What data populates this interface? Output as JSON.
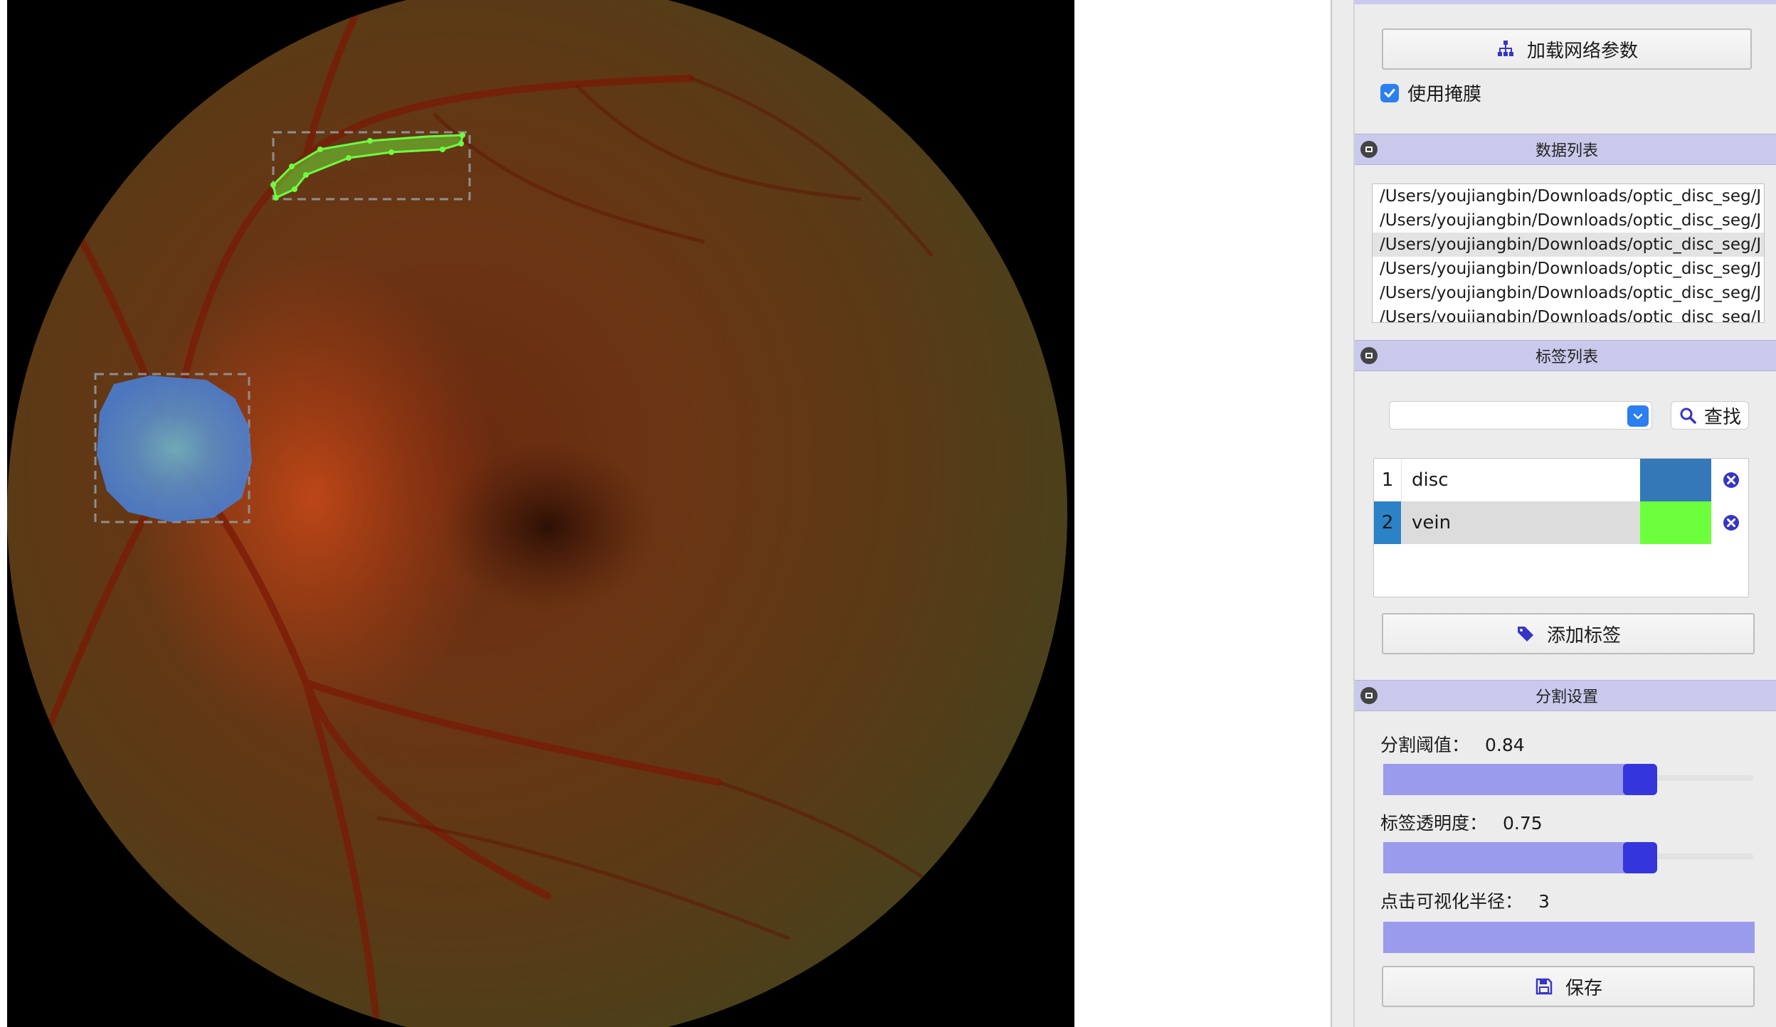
{
  "image": {
    "annotations": [
      {
        "label": "vein",
        "color": "#6dff3f"
      },
      {
        "label": "disc",
        "color": "#3a7ec0"
      }
    ]
  },
  "panel": {
    "load_params_button": "加载网络参数",
    "use_mask_label": "使用掩膜",
    "use_mask_checked": true,
    "data_list": {
      "title": "数据列表",
      "items": [
        "/Users/youjiangbin/Downloads/optic_disc_seg/J",
        "/Users/youjiangbin/Downloads/optic_disc_seg/J",
        "/Users/youjiangbin/Downloads/optic_disc_seg/J",
        "/Users/youjiangbin/Downloads/optic_disc_seg/J",
        "/Users/youjiangbin/Downloads/optic_disc_seg/J",
        "/Users/youjiangbin/Downloads/optic_disc_seg/J"
      ],
      "selected_index": 2
    },
    "label_list": {
      "title": "标签列表",
      "search_value": "",
      "find_button": "查找",
      "labels": [
        {
          "index": "1",
          "name": "disc",
          "color": "#3478b8"
        },
        {
          "index": "2",
          "name": "vein",
          "color": "#6cff3c"
        }
      ],
      "selected_index": 1,
      "add_label_button": "添加标签"
    },
    "segmentation_settings": {
      "title": "分割设置",
      "threshold_label": "分割阈值：",
      "threshold_value": "0.84",
      "threshold_level": 0.84,
      "opacity_label": "标签透明度：",
      "opacity_value": "0.75",
      "opacity_level": 0.75,
      "radius_label": "点击可视化半径：",
      "radius_value": "3",
      "radius_level": 1.0,
      "save_button": "保存"
    },
    "colors": {
      "accent": "#2b7ff0",
      "slider_fill": "#9b9bee",
      "slider_handle": "#3535de",
      "section_header": "#c9c9ec",
      "icon": "#3535c8"
    }
  }
}
